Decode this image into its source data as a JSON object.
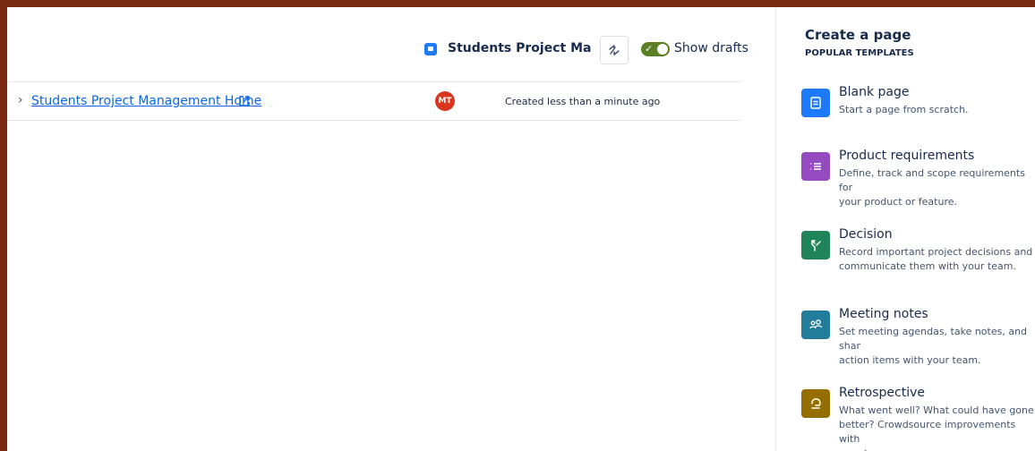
{
  "toolbar": {
    "space_name": "Students Project Manage",
    "show_drafts_label": "Show drafts",
    "show_drafts_on": true
  },
  "pages": [
    {
      "title": "Students Project Management Home",
      "avatar_initials": "MT",
      "created": "Created less than a minute ago"
    }
  ],
  "panel": {
    "title": "Create a page",
    "subtitle": "POPULAR TEMPLATES",
    "templates": [
      {
        "name": "Blank page",
        "description": "Start a page from scratch.",
        "icon": "blank-page-icon",
        "color": "#1d7afc"
      },
      {
        "name": "Product requirements",
        "description": "Define, track and scope requirements for\nyour product or feature.",
        "icon": "list-icon",
        "color": "#964ac0"
      },
      {
        "name": "Decision",
        "description": "Record important project decisions and\ncommunicate them with your team.",
        "icon": "decision-icon",
        "color": "#1f845a"
      },
      {
        "name": "Meeting notes",
        "description": "Set meeting agendas, take notes, and shar\naction items with your team.",
        "icon": "people-icon",
        "color": "#227d9b"
      },
      {
        "name": "Retrospective",
        "description": "What went well? What could have gone\nbetter? Crowdsource improvements with\nyour team.",
        "icon": "retro-icon",
        "color": "#946f00"
      }
    ]
  },
  "colors": {
    "accent": "#0c66e4",
    "toggle_on": "#5b7f24",
    "avatar": "#d9361e",
    "background_frame": "#7a2a10"
  }
}
